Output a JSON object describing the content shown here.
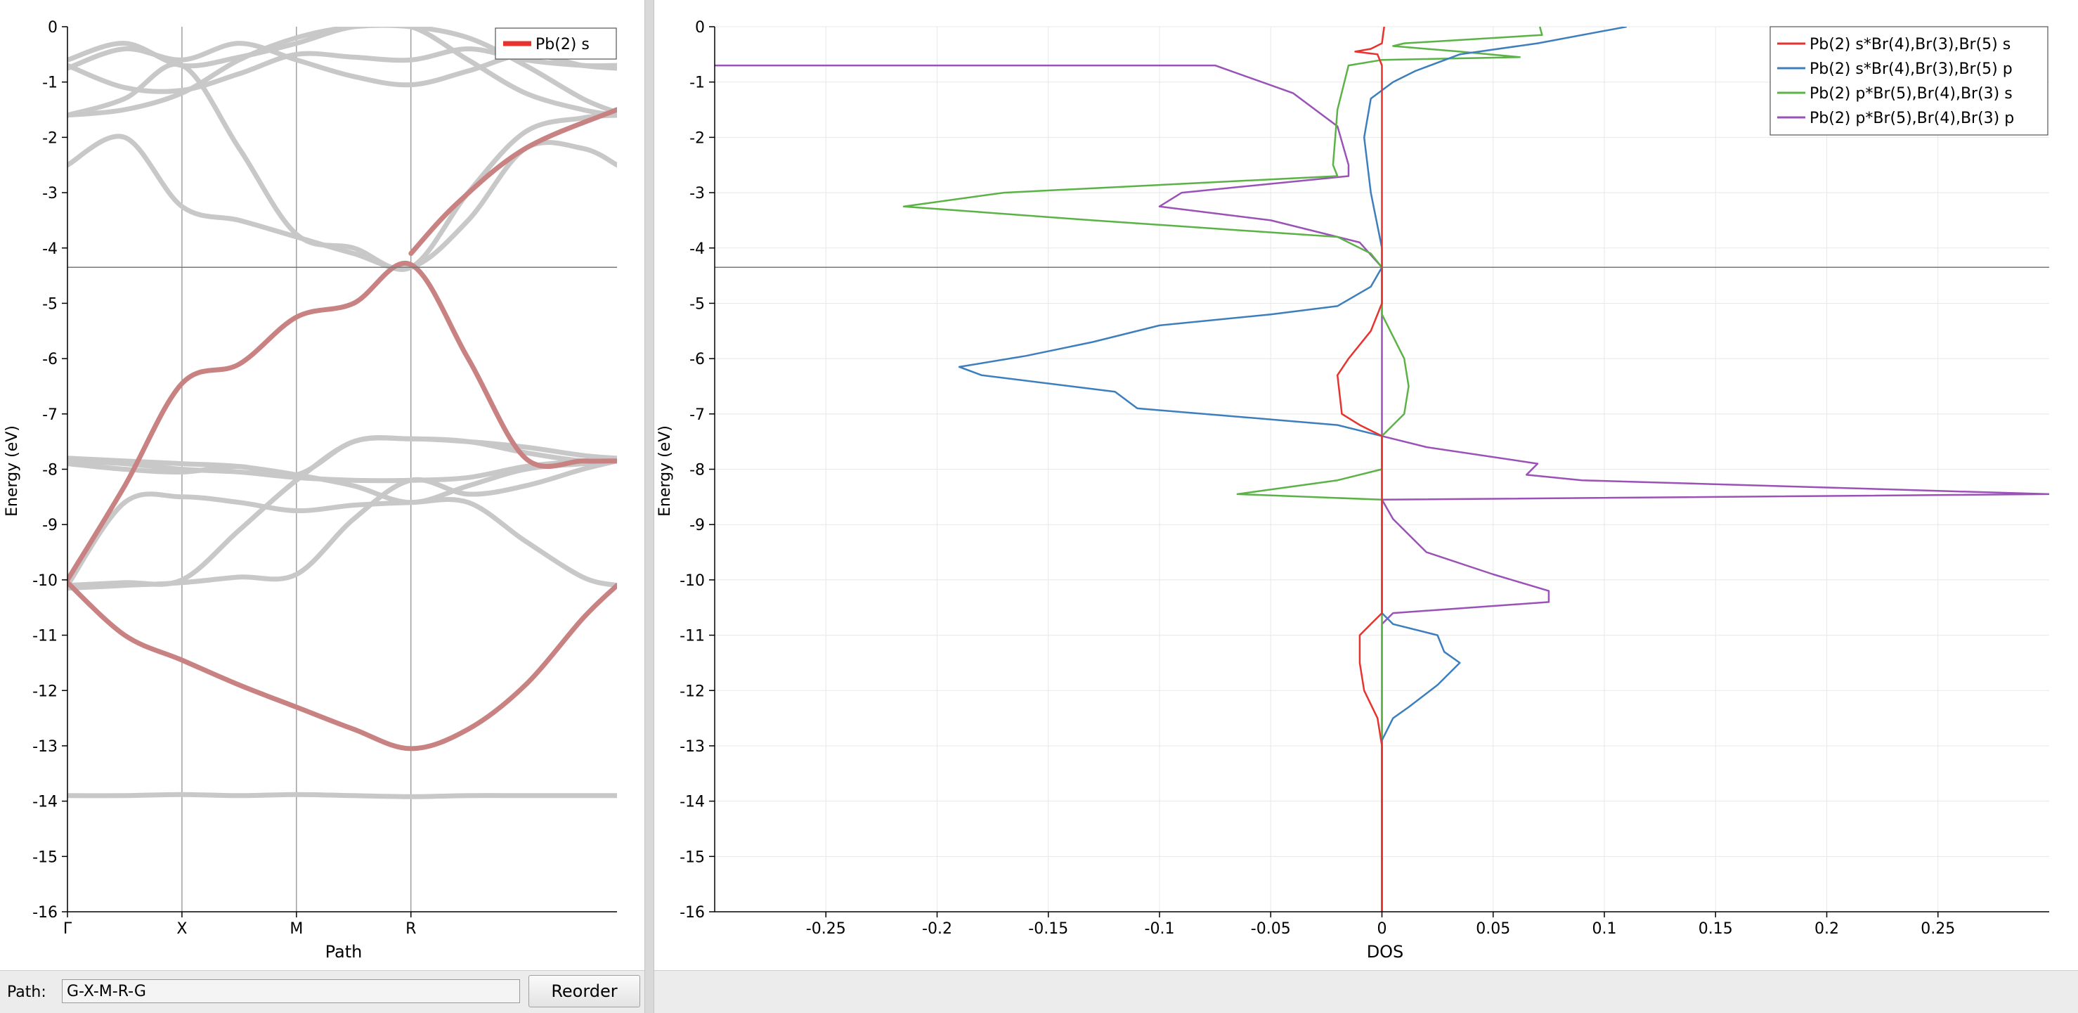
{
  "colors": {
    "band_gray": "#c8c8c8",
    "band_highlight": "#c98282",
    "red": "#e8322d",
    "blue": "#3d7ebd",
    "green": "#5bb346",
    "purple": "#9a52b8",
    "axis": "#000000",
    "grid": "#e8e8e8",
    "vline": "#888888"
  },
  "controls": {
    "path_label": "Path:",
    "path_value": "G-X-M-R-G",
    "reorder_label": "Reorder"
  },
  "chart_data": [
    {
      "type": "line",
      "xlabel": "Path",
      "ylabel": "Energy (eV)",
      "ylim": [
        -16,
        0
      ],
      "yticks": [
        "0",
        "-1",
        "-2",
        "-3",
        "-4",
        "-5",
        "-6",
        "-7",
        "-8",
        "-9",
        "-10",
        "-11",
        "-12",
        "-13",
        "-14",
        "-15",
        "-16"
      ],
      "kpoint_labels": [
        "Γ",
        "X",
        "M",
        "R"
      ],
      "kpoint_x": [
        0,
        1,
        2,
        3
      ],
      "xlim": [
        0,
        4.8
      ],
      "fermi_level": -4.35,
      "legend": {
        "entries": [
          "Pb(2)  s"
        ],
        "position": "top-right"
      },
      "highlight_bands": [
        {
          "name": "Pb(2)  s",
          "x": [
            0,
            0.5,
            1,
            1.5,
            2,
            2.5,
            3,
            3.5,
            4,
            4.5,
            4.8
          ],
          "y": [
            -10.0,
            -8.3,
            -6.45,
            -6.1,
            -5.25,
            -5.0,
            -4.3,
            -6.0,
            -7.8,
            -7.85,
            -7.85
          ]
        },
        {
          "name": "Pb(2)  s",
          "x": [
            0,
            0.5,
            1,
            1.5,
            2,
            2.5,
            3,
            3.5,
            4,
            4.5,
            4.8
          ],
          "y": [
            -10.05,
            -11.0,
            -11.45,
            -11.9,
            -12.3,
            -12.7,
            -13.05,
            -12.7,
            -11.9,
            -10.7,
            -10.1
          ]
        },
        {
          "name": "Pb(2)  s",
          "x": [
            3,
            3.4,
            4.0,
            4.8
          ],
          "y": [
            -4.1,
            -3.2,
            -2.2,
            -1.5
          ]
        }
      ],
      "gray_bands": [
        {
          "x": [
            0,
            0.5,
            1,
            1.5,
            2,
            2.5,
            3,
            3.5,
            4,
            4.5,
            4.8
          ],
          "y": [
            -13.9,
            -13.9,
            -13.88,
            -13.9,
            -13.88,
            -13.9,
            -13.92,
            -13.9,
            -13.9,
            -13.9,
            -13.9
          ]
        },
        {
          "x": [
            0,
            0.5,
            1,
            1.5,
            2,
            2.5,
            3,
            3.5,
            4,
            4.5,
            4.8
          ],
          "y": [
            -10.1,
            -8.6,
            -8.5,
            -8.6,
            -8.75,
            -8.65,
            -8.6,
            -8.6,
            -9.3,
            -9.95,
            -10.1
          ]
        },
        {
          "x": [
            0,
            0.5,
            1,
            1.5,
            2,
            2.5,
            3,
            3.5,
            4,
            4.5,
            4.8
          ],
          "y": [
            -10.15,
            -10.1,
            -10.05,
            -9.95,
            -9.9,
            -8.9,
            -8.2,
            -8.45,
            -8.3,
            -8.0,
            -7.85
          ]
        },
        {
          "x": [
            0,
            0.5,
            1,
            1.5,
            2,
            2.5,
            3,
            3.5,
            4,
            4.5,
            4.8
          ],
          "y": [
            -10.1,
            -10.05,
            -10.0,
            -9.1,
            -8.2,
            -7.5,
            -7.45,
            -7.5,
            -7.7,
            -7.85,
            -7.85
          ]
        },
        {
          "x": [
            0,
            0.5,
            1,
            1.5,
            2,
            2.5,
            3,
            3.5,
            4,
            4.5,
            4.8
          ],
          "y": [
            -7.8,
            -7.85,
            -7.9,
            -7.95,
            -8.1,
            -8.3,
            -8.6,
            -8.3,
            -8.0,
            -7.9,
            -7.85
          ]
        },
        {
          "x": [
            0,
            0.5,
            1,
            1.5,
            2,
            2.5,
            3,
            3.5,
            4,
            4.5,
            4.8
          ],
          "y": [
            -7.85,
            -7.9,
            -8.0,
            -8.05,
            -8.15,
            -8.2,
            -8.2,
            -8.15,
            -7.95,
            -7.85,
            -7.8
          ]
        },
        {
          "x": [
            0,
            0.5,
            1,
            1.5,
            2,
            2.5,
            3,
            3.5,
            4,
            4.5,
            4.8
          ],
          "y": [
            -7.9,
            -8.0,
            -8.05,
            -7.95,
            -8.1,
            -7.5,
            -7.45,
            -7.5,
            -7.6,
            -7.75,
            -7.8
          ]
        },
        {
          "x": [
            0,
            0.5,
            1,
            1.5,
            2,
            2.5,
            3,
            3.5,
            4,
            4.5,
            4.8
          ],
          "y": [
            -2.5,
            -2.0,
            -3.25,
            -3.5,
            -3.8,
            -4.1,
            -4.35,
            -3.5,
            -2.2,
            -2.2,
            -2.5
          ]
        },
        {
          "x": [
            0,
            0.5,
            1,
            1.5,
            2,
            2.5,
            3,
            3.5,
            4,
            4.5,
            4.8
          ],
          "y": [
            -1.6,
            -1.3,
            -0.7,
            -2.2,
            -3.75,
            -4.0,
            -4.35,
            -3.0,
            -1.9,
            -1.65,
            -1.6
          ]
        },
        {
          "x": [
            0,
            0.5,
            1,
            1.5,
            2,
            2.5,
            3,
            3.5,
            4,
            4.5,
            4.8
          ],
          "y": [
            -0.75,
            -0.4,
            -0.6,
            -0.3,
            -0.6,
            -0.9,
            -1.05,
            -0.8,
            -0.5,
            -0.7,
            -0.75
          ]
        },
        {
          "x": [
            0,
            0.5,
            1,
            1.5,
            2,
            2.5,
            3,
            3.5,
            4,
            4.5,
            4.8
          ],
          "y": [
            -0.7,
            -1.1,
            -1.15,
            -0.85,
            -0.5,
            -0.55,
            -0.6,
            -0.4,
            -0.6,
            -0.7,
            -0.7
          ]
        },
        {
          "x": [
            0,
            0.5,
            1,
            1.5,
            2,
            2.5,
            3,
            3.5,
            4,
            4.5,
            4.8
          ],
          "y": [
            -1.6,
            -1.5,
            -1.2,
            -0.6,
            -0.2,
            0.0,
            0.0,
            -0.2,
            -0.7,
            -1.3,
            -1.55
          ]
        },
        {
          "x": [
            0,
            0.5,
            1,
            1.5,
            2,
            2.5,
            3,
            3.5,
            4,
            4.5,
            4.8
          ],
          "y": [
            -0.6,
            -0.3,
            -0.7,
            -0.55,
            -0.3,
            0.0,
            0.0,
            -0.6,
            -1.2,
            -1.5,
            -1.6
          ]
        }
      ]
    },
    {
      "type": "line",
      "xlabel": "DOS",
      "ylabel": "Energy (eV)",
      "ylim": [
        -16,
        0
      ],
      "xlim": [
        -0.3,
        0.3
      ],
      "xticks": [
        "-0.25",
        "-0.2",
        "-0.15",
        "-0.1",
        "-0.05",
        "0",
        "0.05",
        "0.1",
        "0.15",
        "0.2",
        "0.25"
      ],
      "yticks": [
        "0",
        "-1",
        "-2",
        "-3",
        "-4",
        "-5",
        "-6",
        "-7",
        "-8",
        "-9",
        "-10",
        "-11",
        "-12",
        "-13",
        "-14",
        "-15",
        "-16"
      ],
      "fermi_level": -4.35,
      "legend": {
        "position": "top-right"
      },
      "series": [
        {
          "name": "Pb(2) s*Br(4),Br(3),Br(5) s",
          "points": [
            [
              0.001,
              0.0
            ],
            [
              0.0,
              -0.3
            ],
            [
              -0.005,
              -0.4
            ],
            [
              -0.012,
              -0.45
            ],
            [
              -0.002,
              -0.5
            ],
            [
              0.0,
              -0.7
            ],
            [
              0.0,
              -4.3
            ],
            [
              0.0,
              -5.0
            ],
            [
              -0.005,
              -5.5
            ],
            [
              -0.015,
              -6.0
            ],
            [
              -0.02,
              -6.3
            ],
            [
              -0.018,
              -7.0
            ],
            [
              -0.01,
              -7.2
            ],
            [
              0.0,
              -7.4
            ],
            [
              0.0,
              -10.6
            ],
            [
              -0.005,
              -10.8
            ],
            [
              -0.01,
              -11.0
            ],
            [
              -0.01,
              -11.5
            ],
            [
              -0.008,
              -12.0
            ],
            [
              -0.002,
              -12.5
            ],
            [
              0.0,
              -13.0
            ],
            [
              0.0,
              -16.0
            ]
          ]
        },
        {
          "name": "Pb(2) s*Br(4),Br(3),Br(5) p",
          "points": [
            [
              0.11,
              0.0
            ],
            [
              0.07,
              -0.3
            ],
            [
              0.035,
              -0.5
            ],
            [
              0.015,
              -0.8
            ],
            [
              0.005,
              -1.0
            ],
            [
              -0.005,
              -1.3
            ],
            [
              -0.008,
              -2.0
            ],
            [
              -0.005,
              -3.0
            ],
            [
              0.0,
              -4.0
            ],
            [
              0.0,
              -4.35
            ],
            [
              -0.005,
              -4.7
            ],
            [
              -0.02,
              -5.05
            ],
            [
              -0.05,
              -5.2
            ],
            [
              -0.1,
              -5.4
            ],
            [
              -0.13,
              -5.7
            ],
            [
              -0.16,
              -5.95
            ],
            [
              -0.19,
              -6.15
            ],
            [
              -0.18,
              -6.3
            ],
            [
              -0.12,
              -6.6
            ],
            [
              -0.11,
              -6.9
            ],
            [
              -0.02,
              -7.2
            ],
            [
              0.0,
              -7.4
            ],
            [
              0.0,
              -7.9
            ],
            [
              0.0,
              -10.6
            ],
            [
              0.005,
              -10.8
            ],
            [
              0.025,
              -11.0
            ],
            [
              0.028,
              -11.3
            ],
            [
              0.035,
              -11.5
            ],
            [
              0.025,
              -11.9
            ],
            [
              0.012,
              -12.3
            ],
            [
              0.005,
              -12.5
            ],
            [
              0.0,
              -12.9
            ],
            [
              0.0,
              -16.0
            ]
          ]
        },
        {
          "name": "Pb(2) p*Br(5),Br(4),Br(3) s",
          "points": [
            [
              0.071,
              0.0
            ],
            [
              0.072,
              -0.15
            ],
            [
              0.01,
              -0.3
            ],
            [
              0.005,
              -0.35
            ],
            [
              0.035,
              -0.45
            ],
            [
              0.062,
              -0.55
            ],
            [
              0.0,
              -0.6
            ],
            [
              -0.015,
              -0.7
            ],
            [
              -0.02,
              -1.5
            ],
            [
              -0.022,
              -2.5
            ],
            [
              -0.02,
              -2.7
            ],
            [
              -0.17,
              -3.0
            ],
            [
              -0.215,
              -3.25
            ],
            [
              -0.13,
              -3.5
            ],
            [
              -0.02,
              -3.8
            ],
            [
              -0.005,
              -4.1
            ],
            [
              0.0,
              -4.35
            ],
            [
              0.0,
              -5.2
            ],
            [
              0.005,
              -5.6
            ],
            [
              0.01,
              -6.0
            ],
            [
              0.012,
              -6.5
            ],
            [
              0.01,
              -7.0
            ],
            [
              0.0,
              -7.4
            ],
            [
              0.0,
              -8.0
            ],
            [
              -0.02,
              -8.2
            ],
            [
              -0.065,
              -8.45
            ],
            [
              0.0,
              -8.55
            ],
            [
              0.0,
              -13.8
            ],
            [
              0.0,
              -14.0
            ],
            [
              0.0,
              -16.0
            ]
          ]
        },
        {
          "name": "Pb(2) p*Br(5),Br(4),Br(3) p",
          "points": [
            [
              -0.3,
              -0.7
            ],
            [
              -0.075,
              -0.7
            ],
            [
              -0.04,
              -1.2
            ],
            [
              -0.02,
              -1.8
            ],
            [
              -0.015,
              -2.5
            ],
            [
              -0.015,
              -2.7
            ],
            [
              -0.09,
              -3.0
            ],
            [
              -0.1,
              -3.25
            ],
            [
              -0.05,
              -3.5
            ],
            [
              -0.01,
              -3.9
            ],
            [
              0.0,
              -4.35
            ],
            [
              0.0,
              -7.4
            ],
            [
              0.02,
              -7.6
            ],
            [
              0.07,
              -7.9
            ],
            [
              0.065,
              -8.1
            ],
            [
              0.09,
              -8.2
            ],
            [
              0.3,
              -8.45
            ],
            [
              -0.0,
              -8.55
            ],
            [
              0.005,
              -8.9
            ],
            [
              0.02,
              -9.5
            ],
            [
              0.05,
              -9.9
            ],
            [
              0.075,
              -10.2
            ],
            [
              0.075,
              -10.4
            ],
            [
              0.005,
              -10.6
            ],
            [
              0.0,
              -10.8
            ],
            [
              0.0,
              -16.0
            ]
          ]
        }
      ]
    }
  ]
}
